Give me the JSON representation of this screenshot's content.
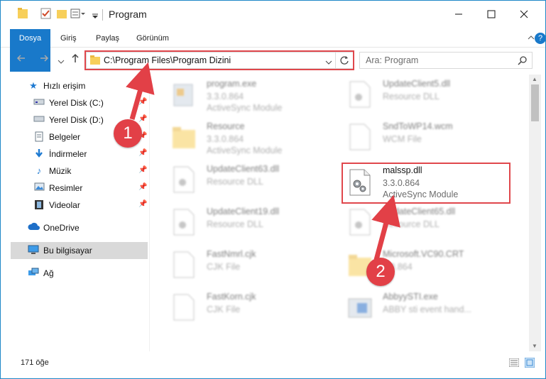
{
  "window": {
    "title": "Program"
  },
  "ribbon": {
    "tabs": [
      "Dosya",
      "Giriş",
      "Paylaş",
      "Görünüm"
    ]
  },
  "address": {
    "path": "C:\\Program Files\\Program Dizini",
    "search_placeholder": "Ara: Program"
  },
  "sidebar": {
    "items": [
      {
        "label": "Hızlı erişim",
        "icon": "star-icon",
        "pinned": false
      },
      {
        "label": "Yerel Disk (C:)",
        "icon": "drive-icon",
        "pinned": true
      },
      {
        "label": "Yerel Disk (D:)",
        "icon": "drive-icon",
        "pinned": true
      },
      {
        "label": "Belgeler",
        "icon": "document-icon",
        "pinned": true
      },
      {
        "label": "İndirmeler",
        "icon": "download-icon",
        "pinned": true
      },
      {
        "label": "Müzik",
        "icon": "music-icon",
        "pinned": true
      },
      {
        "label": "Resimler",
        "icon": "pictures-icon",
        "pinned": true
      },
      {
        "label": "Videolar",
        "icon": "video-icon",
        "pinned": true
      },
      {
        "label": "OneDrive",
        "icon": "cloud-icon",
        "pinned": false
      },
      {
        "label": "Bu bilgisayar",
        "icon": "computer-icon",
        "pinned": false,
        "selected": true
      },
      {
        "label": "Ağ",
        "icon": "network-icon",
        "pinned": false
      }
    ]
  },
  "files": [
    {
      "name": "program.exe",
      "version": "3.3.0.864",
      "type": "ActiveSync Module",
      "icon": "exe-icon"
    },
    {
      "name": "UpdateClient5.dll",
      "version": "Resource DLL",
      "type": "",
      "icon": "dll-icon"
    },
    {
      "name": "Resource",
      "version": "3.3.0.864",
      "type": "ActiveSync Module",
      "icon": "folder-icon"
    },
    {
      "name": "SndToWP14.wcm",
      "version": "WCM File",
      "type": "",
      "icon": "file-icon"
    },
    {
      "name": "UpdateClient63.dll",
      "version": "Resource DLL",
      "type": "",
      "icon": "dll-icon"
    },
    {
      "name": "malssp.dll",
      "version": "3.3.0.864",
      "type": "ActiveSync Module",
      "icon": "dll-icon",
      "highlighted": true
    },
    {
      "name": "UpdateClient19.dll",
      "version": "Resource DLL",
      "type": "",
      "icon": "dll-icon"
    },
    {
      "name": "UpdateClient65.dll",
      "version": "Resource DLL",
      "type": "",
      "icon": "dll-icon"
    },
    {
      "name": "FastNmrl.cjk",
      "version": "CJK File",
      "type": "",
      "icon": "file-icon"
    },
    {
      "name": "Microsoft.VC90.CRT",
      "version": "3.0.864",
      "type": "",
      "icon": "folder-icon"
    },
    {
      "name": "FastKorn.cjk",
      "version": "CJK File",
      "type": "",
      "icon": "file-icon"
    },
    {
      "name": "AbbyySTI.exe",
      "version": "ABBY sti event hand...",
      "type": "",
      "icon": "app-icon"
    }
  ],
  "annotations": {
    "badge1": "1",
    "badge2": "2",
    "accent": "#e24047"
  },
  "status": {
    "count": "171 öğe"
  }
}
